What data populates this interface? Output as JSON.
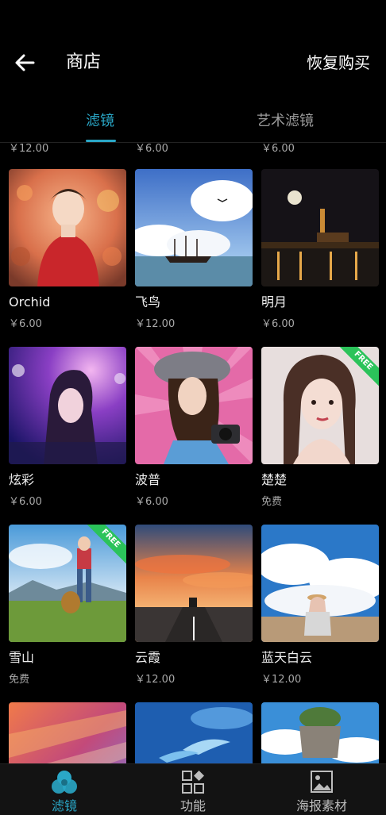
{
  "header": {
    "title": "商店",
    "restore_label": "恢复购买",
    "back_icon": "back-arrow-icon"
  },
  "tabs": [
    {
      "label": "滤镜",
      "active": true
    },
    {
      "label": "艺术滤镜",
      "active": false
    }
  ],
  "top_prices": [
    "￥12.00",
    "￥6.00",
    "￥6.00"
  ],
  "items": [
    {
      "name": "Orchid",
      "price": "￥6.00",
      "free": false
    },
    {
      "name": "飞鸟",
      "price": "￥12.00",
      "free": false
    },
    {
      "name": "明月",
      "price": "￥6.00",
      "free": false
    },
    {
      "name": "炫彩",
      "price": "￥6.00",
      "free": false
    },
    {
      "name": "波普",
      "price": "￥6.00",
      "free": false
    },
    {
      "name": "楚楚",
      "price": "免费",
      "free": true,
      "badge": "FREE"
    },
    {
      "name": "雪山",
      "price": "免费",
      "free": true,
      "badge": "FREE"
    },
    {
      "name": "云霞",
      "price": "￥12.00",
      "free": false
    },
    {
      "name": "蓝天白云",
      "price": "￥12.00",
      "free": false
    }
  ],
  "bottom_nav": [
    {
      "label": "滤镜",
      "icon": "filter-circles-icon",
      "active": true
    },
    {
      "label": "功能",
      "icon": "function-grid-icon",
      "active": false
    },
    {
      "label": "海报素材",
      "icon": "poster-image-icon",
      "active": false
    }
  ],
  "colors": {
    "accent": "#2aa7c7",
    "background": "#000000",
    "free_badge": "#2bc35a"
  }
}
